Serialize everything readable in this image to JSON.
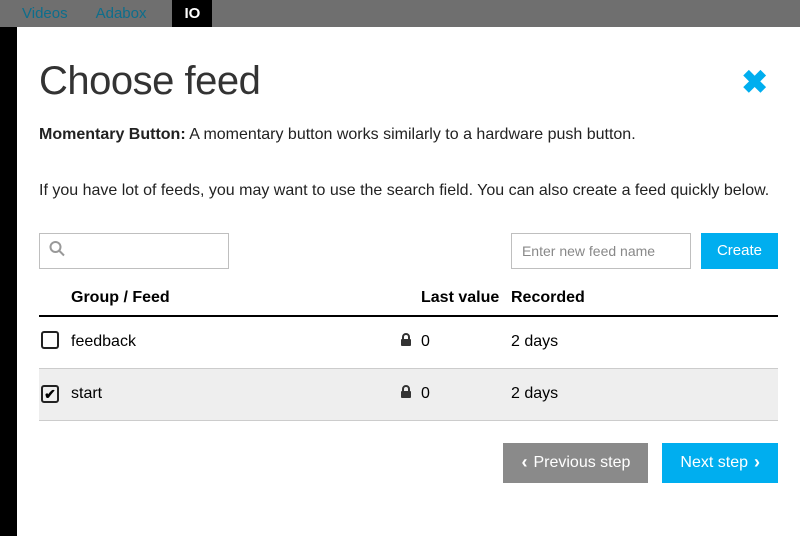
{
  "topbar": {
    "videos": "Videos",
    "adabox": "Adabox",
    "io": "IO"
  },
  "modal": {
    "title": "Choose feed",
    "desc_strong": "Momentary Button:",
    "desc_rest": " A momentary button works similarly to a hardware push button.",
    "helper": "If you have lot of feeds, you may want to use the search field. You can also create a feed quickly below.",
    "search_placeholder": "",
    "newfeed_placeholder": "Enter new feed name",
    "create_label": "Create",
    "prev_label": "Previous step",
    "next_label": "Next step"
  },
  "table": {
    "header": {
      "group": "Group / Feed",
      "last": "Last value",
      "recorded": "Recorded"
    },
    "rows": [
      {
        "checked": false,
        "name": "feedback",
        "locked": true,
        "last": "0",
        "recorded": "2 days"
      },
      {
        "checked": true,
        "name": "start",
        "locked": true,
        "last": "0",
        "recorded": "2 days"
      }
    ]
  }
}
